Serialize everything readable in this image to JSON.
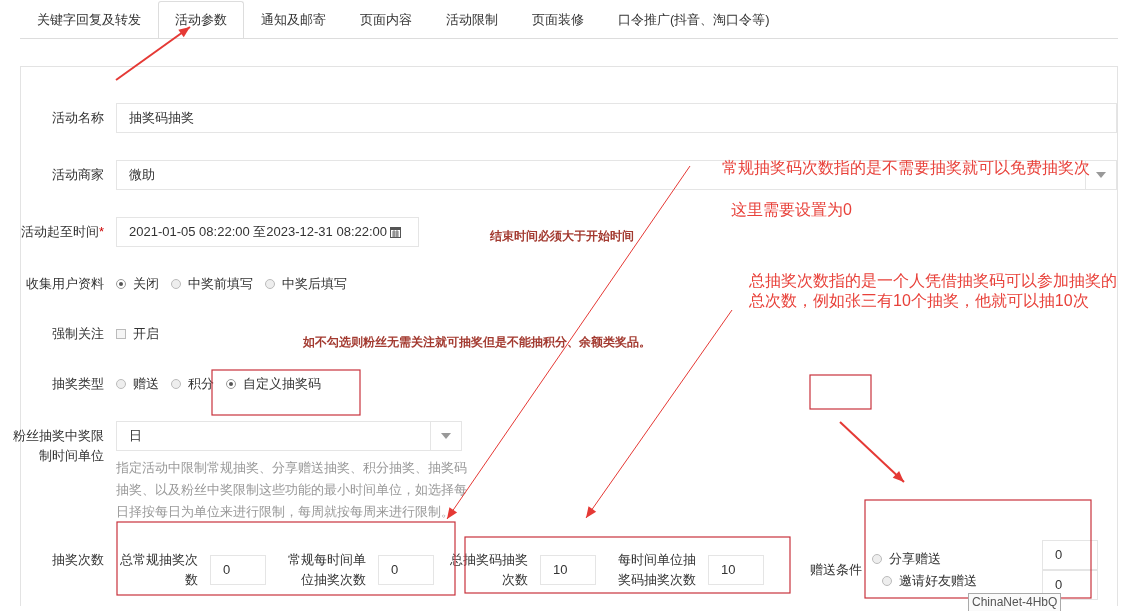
{
  "tabs": [
    {
      "label": "关键字回复及转发",
      "selected": false
    },
    {
      "label": "活动参数",
      "selected": true
    },
    {
      "label": "通知及邮寄",
      "selected": false
    },
    {
      "label": "页面内容",
      "selected": false
    },
    {
      "label": "活动限制",
      "selected": false
    },
    {
      "label": "页面装修",
      "selected": false
    },
    {
      "label": "口令推广(抖音、淘口令等)",
      "selected": false
    }
  ],
  "form": [
    {
      "kind": "text",
      "label": "活动名称",
      "value": "抽奖码抽奖"
    },
    {
      "kind": "select",
      "label": "活动商家",
      "value": "微助"
    },
    {
      "kind": "daterange",
      "label": "活动起至时间",
      "required_mark": "*",
      "value": "2021-01-05 08:22:00 至2023-12-31 08:22:00"
    },
    {
      "kind": "radio",
      "label": "收集用户资料",
      "options": [
        {
          "label": "关闭",
          "selected": true
        },
        {
          "label": "中奖前填写",
          "selected": false
        },
        {
          "label": "中奖后填写",
          "selected": false
        }
      ]
    },
    {
      "kind": "checkbox",
      "label": "强制关注",
      "option": "开启",
      "checked": false
    },
    {
      "kind": "radio",
      "label": "抽奖类型",
      "options": [
        {
          "label": "赠送",
          "selected": false
        },
        {
          "label": "积分",
          "selected": false
        },
        {
          "label": "自定义抽奖码",
          "selected": true
        }
      ]
    },
    {
      "kind": "select_help",
      "label": "粉丝抽奖中奖限制时间单位",
      "value": "日",
      "help": "指定活动中限制常规抽奖、分享赠送抽奖、积分抽奖、抽奖码抽奖、以及粉丝中奖限制这些功能的最小时间单位，如选择每日择按每日为单位来进行限制，每周就按每周来进行限制。"
    },
    {
      "kind": "counts",
      "label": "抽奖次数",
      "fields": [
        {
          "label": "总常规抽奖次数",
          "value": "0"
        },
        {
          "label": "常规每时间单位抽奖次数",
          "value": "0"
        },
        {
          "label": "总抽奖码抽奖次数",
          "value": "10"
        },
        {
          "label": "每时间单位抽奖码抽奖次数",
          "value": "10"
        }
      ],
      "gift": {
        "label": "赠送条件",
        "options": [
          {
            "label": "分享赠送",
            "selected": false,
            "value": "0"
          },
          {
            "label": "邀请好友赠送",
            "selected": false,
            "value": "0"
          }
        ]
      }
    }
  ],
  "annotations": [
    {
      "kind": "note",
      "text": "常规抽奖码次数指的是不需要抽奖就可以免费抽奖次"
    },
    {
      "kind": "note",
      "text": "这里需要设置为0"
    },
    {
      "kind": "warning",
      "text": "结束时间必须大于开始时间"
    },
    {
      "kind": "note",
      "text": "总抽奖次数指的是一个人凭借抽奖码可以参加抽奖的总次数，例如张三有10个抽奖，他就可以抽10次"
    },
    {
      "kind": "warning",
      "text": "如不勾选则粉丝无需关注就可抽奖但是不能抽积分、余额类奖品。"
    }
  ],
  "tooltip": "ChinaNet-4HbQ"
}
